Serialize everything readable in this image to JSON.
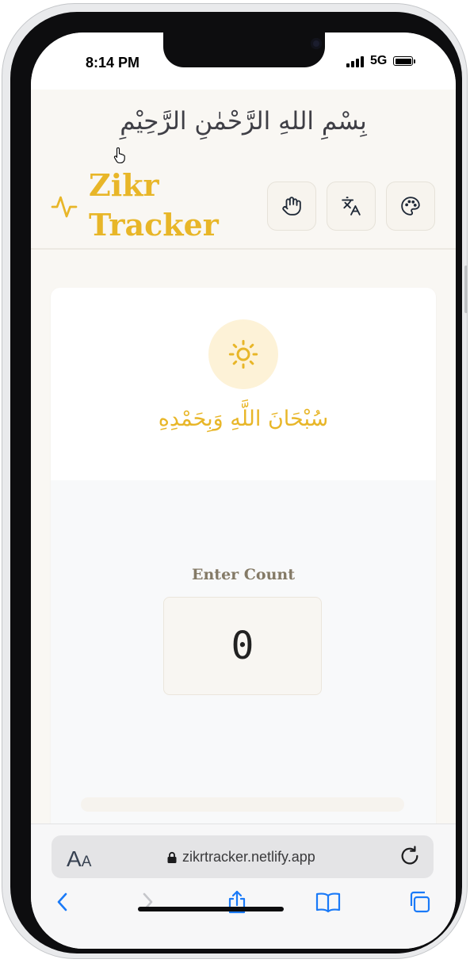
{
  "status_bar": {
    "time": "8:14 PM",
    "network": "5G"
  },
  "page": {
    "bismillah": "بِسْمِ اللهِ الرَّحْمٰنِ الرَّحِيْمِ",
    "logo": {
      "line1": "Zikr",
      "line2": "Tracker",
      "icon": "activity-pulse-icon"
    },
    "header_buttons": [
      {
        "icon": "hand-icon"
      },
      {
        "icon": "translate-icon"
      },
      {
        "icon": "palette-icon"
      }
    ],
    "card": {
      "icon": "sun-icon",
      "dhikr_arabic": "سُبْحَانَ اللَّهِ وَبِحَمْدِهِ",
      "count_label": "Enter Count",
      "count_value": "0",
      "progress": 0
    }
  },
  "browser": {
    "text_size_label_big": "A",
    "text_size_label_small": "A",
    "url": "zikrtracker.netlify.app",
    "toolbar_icons": [
      "back-icon",
      "forward-icon",
      "share-icon",
      "bookmarks-icon",
      "tabs-icon"
    ]
  },
  "colors": {
    "accent": "#e8b628",
    "background": "#f9f7f3",
    "ios_blue": "#1a7af8"
  }
}
